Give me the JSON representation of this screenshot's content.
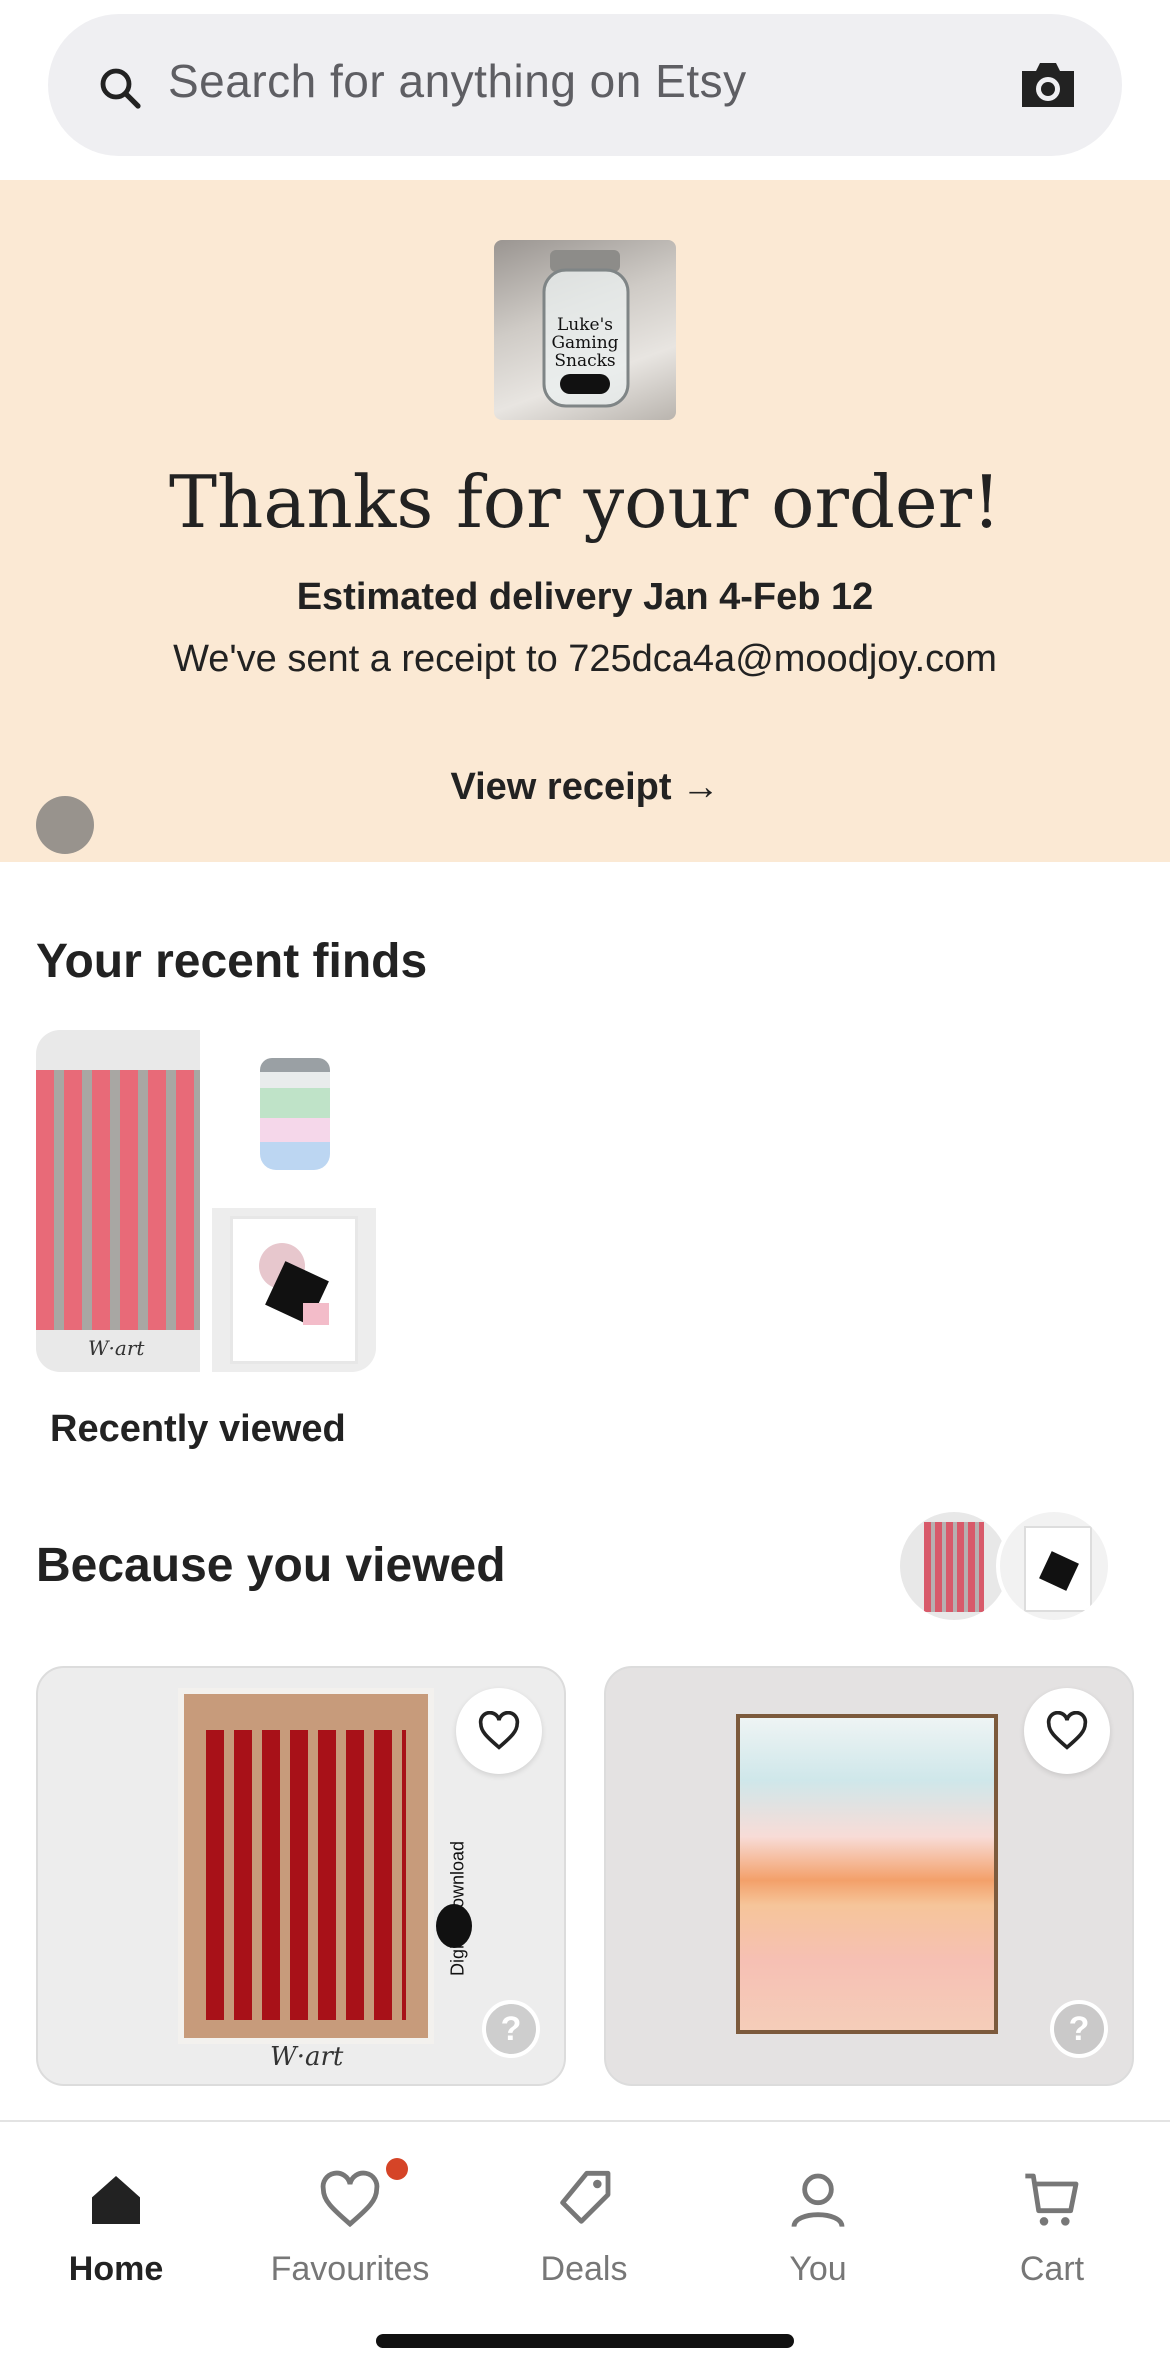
{
  "search": {
    "placeholder": "Search for anything on Etsy",
    "icon": "search-icon",
    "camera_icon": "camera-icon"
  },
  "order_banner": {
    "title": "Thanks for your order!",
    "delivery": "Estimated delivery Jan 4-Feb 12",
    "receipt_message": "We've sent a receipt to 725dca4a@moodjoy.com",
    "view_receipt": "View receipt",
    "arrow": "→",
    "thumbnail_text": "Luke's Gaming Snacks",
    "background_color": "#fbe9d4"
  },
  "recent_finds": {
    "title": "Your recent finds",
    "collection_label": "Recently viewed",
    "signature": "W·art"
  },
  "because_you_viewed": {
    "title": "Because you viewed",
    "cards": [
      {
        "tag": "Digital Download",
        "signature": "W·art",
        "help": "?"
      },
      {
        "help": "?"
      }
    ]
  },
  "tabbar": {
    "items": [
      {
        "label": "Home",
        "icon": "home-icon",
        "active": true
      },
      {
        "label": "Favourites",
        "icon": "heart-icon",
        "active": false,
        "has_notification": true
      },
      {
        "label": "Deals",
        "icon": "tag-icon",
        "active": false
      },
      {
        "label": "You",
        "icon": "person-icon",
        "active": false
      },
      {
        "label": "Cart",
        "icon": "cart-icon",
        "active": false
      }
    ]
  },
  "colors": {
    "accent_notification": "#d54427",
    "text_primary": "#222222",
    "text_secondary": "#777777"
  }
}
